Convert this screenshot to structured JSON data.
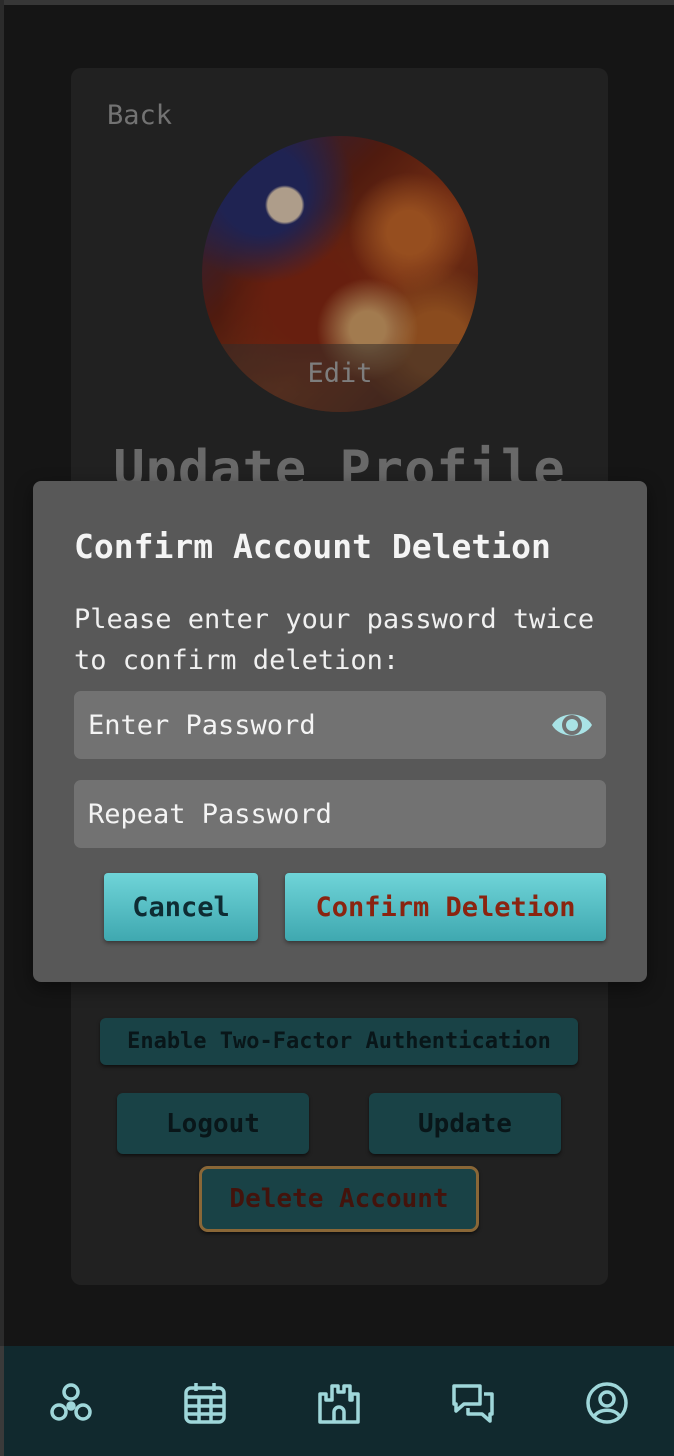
{
  "profile": {
    "back_label": "Back",
    "avatar_edit_label": "Edit",
    "page_title": "Update Profile",
    "twofa_label": "Enable Two-Factor Authentication",
    "logout_label": "Logout",
    "update_label": "Update",
    "delete_account_label": "Delete Account"
  },
  "modal": {
    "title": "Confirm Account Deletion",
    "message": "Please enter your password twice to confirm deletion:",
    "password_placeholder": "Enter Password",
    "repeat_password_placeholder": "Repeat Password",
    "cancel_label": "Cancel",
    "confirm_label": "Confirm Deletion"
  },
  "nav": {
    "items": [
      {
        "icon": "network-icon"
      },
      {
        "icon": "calendar-icon"
      },
      {
        "icon": "castle-icon"
      },
      {
        "icon": "chat-icon"
      },
      {
        "icon": "profile-icon"
      }
    ]
  },
  "colors": {
    "accent": "#5bc0c6",
    "danger_text": "#8a2410",
    "nav_bg": "#11292e",
    "modal_bg": "#585858"
  }
}
